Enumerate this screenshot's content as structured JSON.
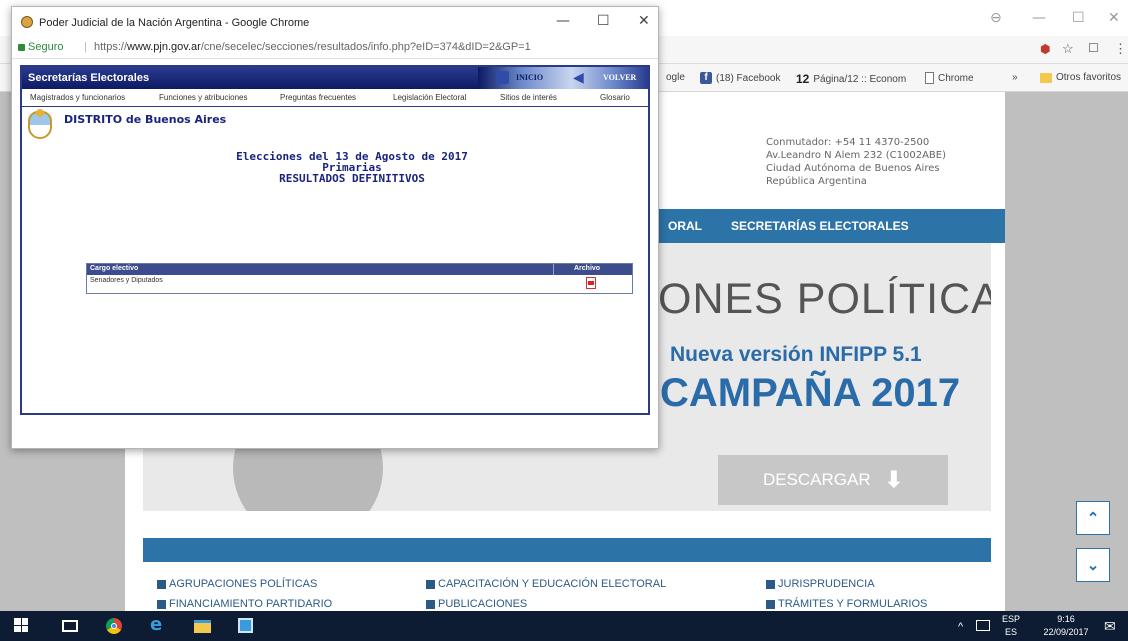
{
  "background_window": {
    "winctl": {
      "profile": "⊖",
      "minimize": "—",
      "maximize": "☐",
      "close": "✕"
    },
    "omnibar_right": {
      "ext_icon": "⬢",
      "star": "☆",
      "ext2": "☐",
      "menu": "⋮"
    },
    "bookmarks": {
      "google_partial": "ogle",
      "facebook_icon": "f",
      "facebook": "(18) Facebook",
      "pagina12_icon": "12",
      "pagina12": "Página/12 :: Econom",
      "chrome": "Chrome",
      "more": "»",
      "otros": "Otros favoritos"
    },
    "contact": {
      "line1": "Conmutador: +54 11 4370-2500",
      "line2": "Av.Leandro N Alem 232 (C1002ABE)",
      "line3": "Ciudad Autónoma de Buenos Aires",
      "line4": "República Argentina"
    },
    "nav": {
      "item1": "ORAL",
      "item2": "SECRETARÍAS ELECTORALES"
    },
    "banner": {
      "big": "ONES POLÍTICAS",
      "sub": "Nueva versión INFIPP 5.1",
      "campaign": "CAMPAÑA 2017",
      "download": "DESCARGAR",
      "download_arrow": "⬇"
    },
    "footer_links": {
      "agrupaciones": "AGRUPACIONES POLÍTICAS",
      "capacitacion": "CAPACITACIÓN Y EDUCACIÓN ELECTORAL",
      "jurisprudencia": "JURISPRUDENCIA",
      "financiamiento": "FINANCIAMIENTO PARTIDARIO",
      "publicaciones": "PUBLICACIONES",
      "tramites": "TRÁMITES Y FORMULARIOS"
    },
    "scroll_up": "⌃",
    "scroll_down": "⌄"
  },
  "popup": {
    "title": "Poder Judicial de la Nación Argentina - Google Chrome",
    "minimize": "—",
    "maximize": "☐",
    "close": "✕",
    "secure_label": "Seguro",
    "separator": "|",
    "url_scheme": "https://",
    "url_host": "www.pjn.gov.ar",
    "url_path": "/cne/secelec/secciones/resultados/info.php?eID=374&dID=2&GP=1",
    "header": {
      "title": "Secretarías Electorales",
      "inicio": "INICIO",
      "volver": "VOLVER"
    },
    "menu": [
      "Magistrados y funcionarios",
      "Funciones y atribuciones",
      "Preguntas frecuentes",
      "Legislación Electoral",
      "Sitios de interés",
      "Glosario"
    ],
    "district": "DISTRITO de Buenos Aires",
    "election": {
      "line1": "Elecciones del 13 de Agosto de 2017",
      "line2": "Primarias",
      "line3": "RESULTADOS DEFINITIVOS"
    },
    "table": {
      "col_cargo": "Cargo electivo",
      "col_archivo": "Archivo",
      "rows": [
        {
          "cargo": "Senadores y Diputados"
        }
      ]
    }
  },
  "taskbar": {
    "lang1": "ESP",
    "lang2": "ES",
    "time": "9:16",
    "date": "22/09/2017",
    "tray_up": "^",
    "notifications": "✉"
  }
}
